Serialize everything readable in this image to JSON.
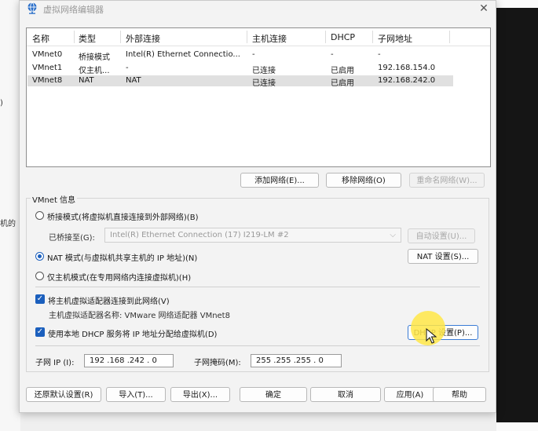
{
  "background": {
    "left_fragments": [
      ")",
      "机的"
    ]
  },
  "dialog": {
    "title": "虚拟网络编辑器",
    "close_glyph": "✕"
  },
  "network_list": {
    "columns": [
      "名称",
      "类型",
      "外部连接",
      "主机连接",
      "DHCP",
      "子网地址"
    ],
    "rows": [
      {
        "name": "VMnet0",
        "type": "桥接模式",
        "external": "Intel(R) Ethernet Connectio...",
        "host": "-",
        "dhcp": "-",
        "subnet": "-"
      },
      {
        "name": "VMnet1",
        "type": "仅主机...",
        "external": "-",
        "host": "已连接",
        "dhcp": "已启用",
        "subnet": "192.168.154.0"
      },
      {
        "name": "VMnet8",
        "type": "NAT",
        "external": "NAT",
        "host": "已连接",
        "dhcp": "已启用",
        "subnet": "192.168.242.0"
      }
    ],
    "selected_row": "VMnet8"
  },
  "list_buttons": {
    "add": "添加网络(E)...",
    "remove": "移除网络(O)",
    "rename": "重命名网络(W)..."
  },
  "vmnet_info": {
    "group_title": "VMnet 信息",
    "bridge_label": "桥接模式(将虚拟机直接连接到外部网络)(B)",
    "bridged_to_label": "已桥接至(G):",
    "bridged_to_value": "Intel(R) Ethernet Connection (17) I219-LM #2",
    "auto_settings": "自动设置(U)...",
    "nat_label": "NAT 模式(与虚拟机共享主机的 IP 地址)(N)",
    "nat_settings": "NAT 设置(S)...",
    "hostonly_label": "仅主机模式(在专用网络内连接虚拟机)(H)",
    "selected_mode": "nat",
    "connect_adapter_label": "将主机虚拟适配器连接到此网络(V)",
    "adapter_name_label": "主机虚拟适配器名称: VMware 网络适配器 VMnet8",
    "dhcp_label": "使用本地 DHCP 服务将 IP 地址分配给虚拟机(D)",
    "dhcp_settings": "DHCP 设置(P)...",
    "check_glyph": "✓",
    "subnet_ip_label": "子网 IP (I):",
    "subnet_ip": "192 .168 .242 . 0",
    "subnet_mask_label": "子网掩码(M):",
    "subnet_mask": "255 .255 .255 . 0"
  },
  "footer_buttons": {
    "restore": "还原默认设置(R)",
    "import": "导入(T)...",
    "export": "导出(X)...",
    "ok": "确定",
    "cancel": "取消",
    "apply": "应用(A)",
    "help": "帮助"
  },
  "colors": {
    "accent": "#1b5fbd",
    "selection": "#e0e0e0",
    "highlight": "#ffe646"
  }
}
